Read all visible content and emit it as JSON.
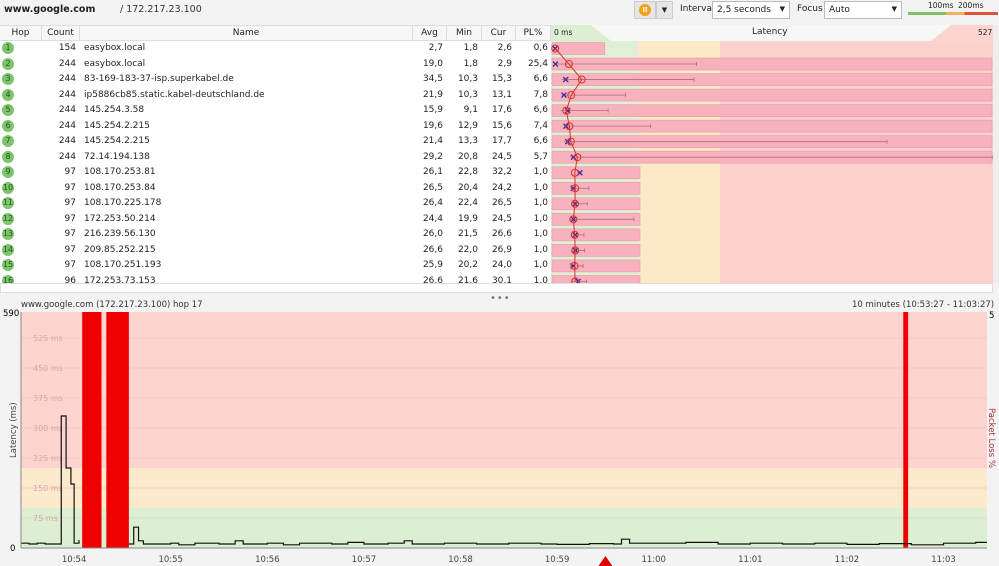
{
  "titlebar": {
    "host": "www.google.com",
    "ip": "/ 172.217.23.100"
  },
  "toolbar": {
    "pause_icon": "pause-icon",
    "dropdown_icon": "chevron-down-icon",
    "interval_label": "Interval",
    "interval_value": "2,5 seconds",
    "focus_label": "Focus",
    "focus_value": "Auto",
    "legend_100": "100ms",
    "legend_200": "200ms"
  },
  "table": {
    "headers": {
      "hop": "Hop",
      "count": "Count",
      "name": "Name",
      "avg": "Avg",
      "min": "Min",
      "cur": "Cur",
      "pl": "PL%",
      "latency": "Latency",
      "lat_min": "0 ms",
      "lat_max": "527"
    },
    "latency_scale_max": 527,
    "packet_loss_scale_max": 5,
    "colors": {
      "good": "#dff0d6",
      "warn": "#fde9c7",
      "bad": "#fcd0cc",
      "pl_bar": "#f7b2bd",
      "avg_line": "#d9322b",
      "cur_marker": "#3a2aa8"
    },
    "rows": [
      {
        "hop": "1",
        "count": "154",
        "name": "easybox.local",
        "avg": "2,7",
        "min": "1,8",
        "cur": "2,6",
        "pl": "0,6",
        "max": 3
      },
      {
        "hop": "2",
        "count": "244",
        "name": "easybox.local",
        "avg": "19,0",
        "min": "1,8",
        "cur": "2,9",
        "pl": "25,4",
        "max": 172
      },
      {
        "hop": "3",
        "count": "244",
        "name": "83-169-183-37-isp.superkabel.de",
        "avg": "34,5",
        "min": "10,3",
        "cur": "15,3",
        "pl": "6,6",
        "max": 169
      },
      {
        "hop": "4",
        "count": "244",
        "name": "ip5886cb85.static.kabel-deutschland.de",
        "avg": "21,9",
        "min": "10,3",
        "cur": "13,1",
        "pl": "7,8",
        "max": 87
      },
      {
        "hop": "5",
        "count": "244",
        "name": "145.254.3.58",
        "avg": "15,9",
        "min": "9,1",
        "cur": "17,6",
        "pl": "6,6",
        "max": 66
      },
      {
        "hop": "6",
        "count": "244",
        "name": "145.254.2.215",
        "avg": "19,6",
        "min": "12,9",
        "cur": "15,6",
        "pl": "7,4",
        "max": 117
      },
      {
        "hop": "7",
        "count": "244",
        "name": "145.254.2.215",
        "avg": "21,4",
        "min": "13,3",
        "cur": "17,7",
        "pl": "6,6",
        "max": 400
      },
      {
        "hop": "8",
        "count": "244",
        "name": "72.14.194.138",
        "avg": "29,2",
        "min": "20,8",
        "cur": "24,5",
        "pl": "5,7",
        "max": 527
      },
      {
        "hop": "9",
        "count": "97",
        "name": "108.170.253.81",
        "avg": "26,1",
        "min": "22,8",
        "cur": "32,2",
        "pl": "1,0",
        "max": 32
      },
      {
        "hop": "10",
        "count": "97",
        "name": "108.170.253.84",
        "avg": "26,5",
        "min": "20,4",
        "cur": "24,2",
        "pl": "1,0",
        "max": 43
      },
      {
        "hop": "11",
        "count": "97",
        "name": "108.170.225.178",
        "avg": "26,4",
        "min": "22,4",
        "cur": "26,5",
        "pl": "1,0",
        "max": 41
      },
      {
        "hop": "12",
        "count": "97",
        "name": "172.253.50.214",
        "avg": "24,4",
        "min": "19,9",
        "cur": "24,5",
        "pl": "1,0",
        "max": 97
      },
      {
        "hop": "13",
        "count": "97",
        "name": "216.239.56.130",
        "avg": "26,0",
        "min": "21,5",
        "cur": "26,6",
        "pl": "1,0",
        "max": 37
      },
      {
        "hop": "14",
        "count": "97",
        "name": "209.85.252.215",
        "avg": "26,6",
        "min": "22,0",
        "cur": "26,9",
        "pl": "1,0",
        "max": 38
      },
      {
        "hop": "15",
        "count": "97",
        "name": "108.170.251.193",
        "avg": "25,9",
        "min": "20,2",
        "cur": "24,0",
        "pl": "1,0",
        "max": 36
      },
      {
        "hop": "16",
        "count": "96",
        "name": "172.253.73.153",
        "avg": "26,6",
        "min": "21,6",
        "cur": "30,1",
        "pl": "1,0",
        "max": 40
      }
    ]
  },
  "chart_data": {
    "type": "line",
    "title": "www.google.com (172.217.23.100) hop 17",
    "range_label": "10 minutes (10:53:27 - 11:03:27)",
    "ylabel": "Latency (ms)",
    "y2label": "Packet Loss %",
    "ylim": [
      0,
      590
    ],
    "y2_max_label": "5",
    "y_top_label": "590",
    "y_zero_label": "0",
    "xlim": [
      "10:53:27",
      "11:03:27"
    ],
    "grid_labels": [
      "75 ms",
      "150 ms",
      "225 ms",
      "300 ms",
      "375 ms",
      "450 ms",
      "525 ms"
    ],
    "grid_values": [
      75,
      150,
      225,
      300,
      375,
      450,
      525
    ],
    "zones": [
      {
        "to": 100,
        "color": "#dcefd3"
      },
      {
        "to": 200,
        "color": "#fde9cb"
      },
      {
        "to": 590,
        "color": "#fdd4d0"
      }
    ],
    "x_ticks": [
      "10:54",
      "10:55",
      "10:56",
      "10:57",
      "10:58",
      "10:59",
      "11:00",
      "11:01",
      "11:02",
      "11:03"
    ],
    "packet_loss_periods": [
      [
        "10:54:05",
        "10:54:17"
      ],
      [
        "10:54:20",
        "10:54:34"
      ],
      [
        "11:02:35",
        "11:02:38"
      ]
    ],
    "marker_time": "10:59:30",
    "latency": [
      [
        "10:53:27",
        12
      ],
      [
        "10:53:32",
        10
      ],
      [
        "10:53:37",
        12
      ],
      [
        "10:53:42",
        10
      ],
      [
        "10:53:50",
        10
      ],
      [
        "10:53:52",
        330
      ],
      [
        "10:53:55",
        200
      ],
      [
        "10:53:58",
        160
      ],
      [
        "10:54:00",
        12
      ],
      [
        "10:54:03",
        20
      ],
      [
        "10:54:05",
        null
      ],
      [
        "10:54:17",
        535
      ],
      [
        "10:54:20",
        null
      ],
      [
        "10:54:34",
        10
      ],
      [
        "10:54:37",
        52
      ],
      [
        "10:54:40",
        18
      ],
      [
        "10:54:43",
        10
      ],
      [
        "10:55:00",
        12
      ],
      [
        "10:55:05",
        8
      ],
      [
        "10:55:15",
        12
      ],
      [
        "10:55:30",
        10
      ],
      [
        "10:55:40",
        18
      ],
      [
        "10:55:45",
        10
      ],
      [
        "10:56:00",
        12
      ],
      [
        "10:56:10",
        8
      ],
      [
        "10:56:20",
        12
      ],
      [
        "10:56:40",
        10
      ],
      [
        "10:56:50",
        14
      ],
      [
        "10:57:00",
        10
      ],
      [
        "10:57:15",
        12
      ],
      [
        "10:57:25",
        18
      ],
      [
        "10:57:30",
        10
      ],
      [
        "10:57:50",
        12
      ],
      [
        "10:58:10",
        10
      ],
      [
        "10:58:30",
        12
      ],
      [
        "10:58:50",
        10
      ],
      [
        "10:59:00",
        9
      ],
      [
        "10:59:20",
        11
      ],
      [
        "10:59:35",
        10
      ],
      [
        "10:59:40",
        22
      ],
      [
        "10:59:45",
        12
      ],
      [
        "11:00:00",
        12
      ],
      [
        "11:00:20",
        14
      ],
      [
        "11:00:40",
        10
      ],
      [
        "11:01:00",
        12
      ],
      [
        "11:01:20",
        10
      ],
      [
        "11:01:40",
        12
      ],
      [
        "11:02:00",
        9
      ],
      [
        "11:02:20",
        11
      ],
      [
        "11:02:40",
        8
      ],
      [
        "11:03:00",
        12
      ],
      [
        "11:03:20",
        14
      ],
      [
        "11:03:27",
        14
      ]
    ]
  }
}
